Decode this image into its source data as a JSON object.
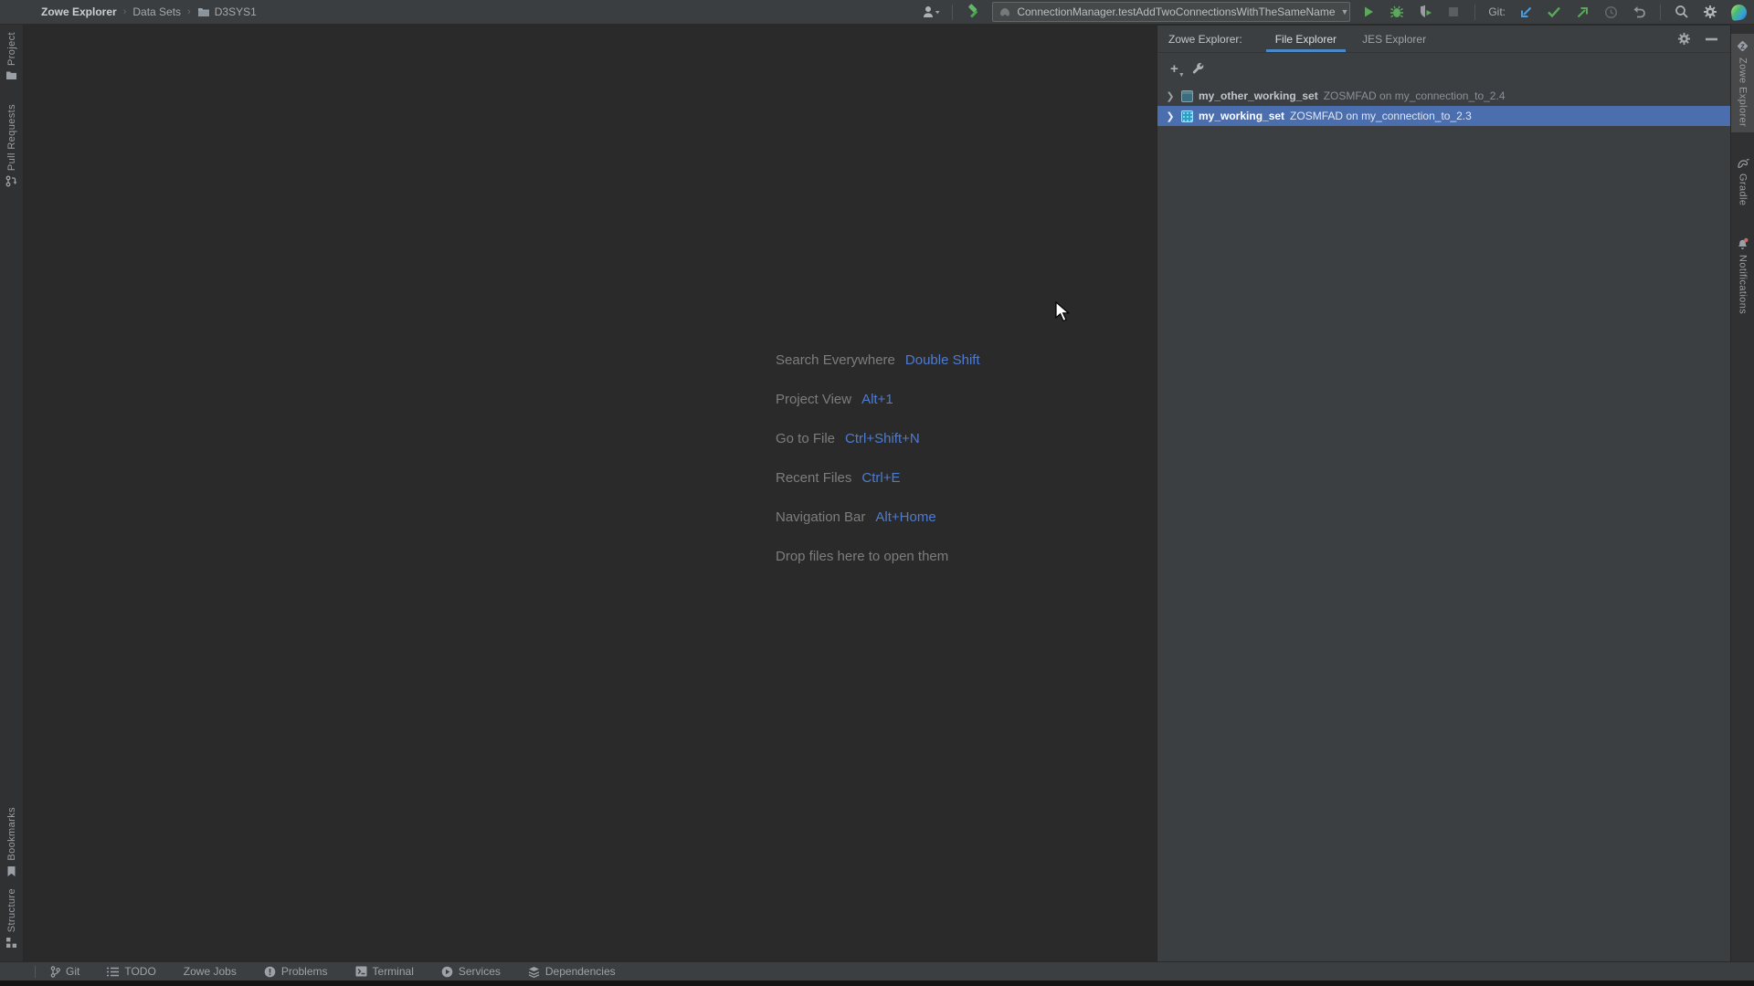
{
  "breadcrumb": {
    "root": "Zowe Explorer",
    "items": [
      "Data Sets",
      "D3SYS1"
    ]
  },
  "topbar": {
    "run_config": "ConnectionManager.testAddTwoConnectionsWithTheSameName",
    "git_label": "Git:"
  },
  "left_stripe": {
    "project": "Project",
    "pull_requests": "Pull Requests",
    "bookmarks": "Bookmarks",
    "structure": "Structure"
  },
  "right_stripe": {
    "zowe_explorer": "Zowe Explorer",
    "gradle": "Gradle",
    "notifications": "Notifications"
  },
  "panel": {
    "title": "Zowe Explorer:",
    "tabs": {
      "file": "File Explorer",
      "jes": "JES Explorer"
    },
    "tree": [
      {
        "name": "my_other_working_set",
        "detail": "ZOSMFAD on my_connection_to_2.4"
      },
      {
        "name": "my_working_set",
        "detail": "ZOSMFAD on my_connection_to_2.3"
      }
    ]
  },
  "hints": {
    "rows": [
      {
        "label": "Search Everywhere",
        "key": "Double Shift"
      },
      {
        "label": "Project View",
        "key": "Alt+1"
      },
      {
        "label": "Go to File",
        "key": "Ctrl+Shift+N"
      },
      {
        "label": "Recent Files",
        "key": "Ctrl+E"
      },
      {
        "label": "Navigation Bar",
        "key": "Alt+Home"
      }
    ],
    "drop": "Drop files here to open them"
  },
  "statusbar": {
    "git": "Git",
    "todo": "TODO",
    "zowe_jobs": "Zowe Jobs",
    "problems": "Problems",
    "terminal": "Terminal",
    "services": "Services",
    "dependencies": "Dependencies"
  },
  "colors": {
    "selection_blue": "#4b6eaf",
    "tab_underline_blue": "#4a88c7",
    "shortcut_blue": "#4e7bd0",
    "run_green": "#5ca85c",
    "git_update_blue": "#4a9edd"
  }
}
